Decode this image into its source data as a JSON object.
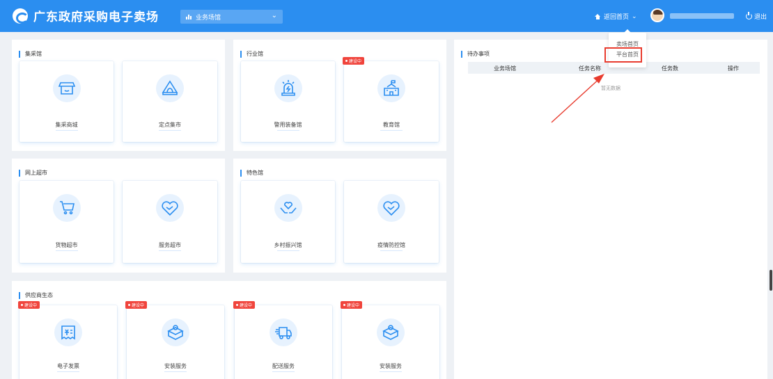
{
  "header": {
    "app_title": "广东政府采购电子卖场",
    "venue_select": "业务场馆",
    "back_home": "返回首页",
    "logout": "退出"
  },
  "dropdown": {
    "items": [
      "卖场首页",
      "平台首页"
    ],
    "highlighted": "平台首页"
  },
  "panels": {
    "collective": {
      "title": "集采馆",
      "cards": [
        {
          "label": "集采商城",
          "icon": "store-icon"
        },
        {
          "label": "定点集市",
          "icon": "tent-icon"
        }
      ]
    },
    "industry": {
      "title": "行业馆",
      "cards": [
        {
          "label": "警用装备馆",
          "icon": "police-alarm-icon"
        },
        {
          "label": "教育馆",
          "icon": "school-icon",
          "badge": "建设中"
        }
      ]
    },
    "online_market": {
      "title": "网上超市",
      "cards": [
        {
          "label": "货物超市",
          "icon": "shopping-cart-icon"
        },
        {
          "label": "服务超市",
          "icon": "handshake-heart-icon"
        }
      ]
    },
    "special": {
      "title": "特色馆",
      "cards": [
        {
          "label": "乡村振兴馆",
          "icon": "hands-heart-icon"
        },
        {
          "label": "疫情防控馆",
          "icon": "handshake-heart-icon"
        }
      ]
    },
    "supplier": {
      "title": "供应商生态",
      "cards": [
        {
          "label": "电子发票",
          "icon": "invoice-icon",
          "badge": "建设中"
        },
        {
          "label": "安装服务",
          "icon": "install-box-icon",
          "badge": "建设中"
        },
        {
          "label": "配送服务",
          "icon": "delivery-truck-icon",
          "badge": "建设中"
        },
        {
          "label": "安装服务",
          "icon": "install-box-icon",
          "badge": "建设中"
        }
      ]
    },
    "todo": {
      "title": "待办事项",
      "columns": [
        "业务场馆",
        "任务名称",
        "任务数",
        "操作"
      ],
      "empty_text": "暂无数据"
    }
  },
  "colors": {
    "header": "#2b8ef0",
    "accent": "#2b8ef0",
    "badge": "#f0443c",
    "highlight": "#e83b2e"
  }
}
